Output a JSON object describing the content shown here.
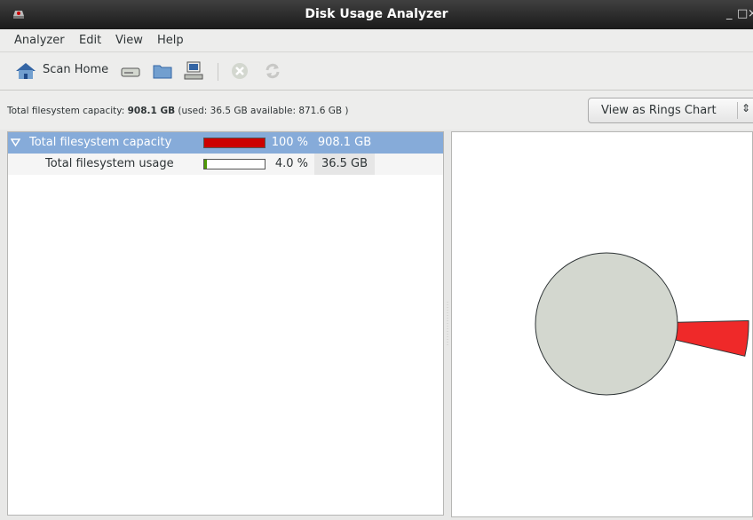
{
  "window": {
    "title": "Disk Usage Analyzer",
    "minimize": "_",
    "maximize": "□",
    "close": "×"
  },
  "menu": [
    "Analyzer",
    "Edit",
    "View",
    "Help"
  ],
  "toolbar": {
    "scan_home_label": "Scan Home"
  },
  "info": {
    "prefix": "Total filesystem capacity: ",
    "capacity": "908.1 GB",
    "suffix": " (used: 36.5 GB available: 871.6 GB )"
  },
  "view_combo": {
    "selected": "View as Rings Chart",
    "arrow": "⇕"
  },
  "tree": {
    "rows": [
      {
        "name": "Total filesystem capacity",
        "percent": "100 %",
        "size": "908.1 GB",
        "fill": 1.0,
        "fill_color": "#cc0000",
        "expanded": true,
        "selected": true
      },
      {
        "name": "Total filesystem usage",
        "percent": "4.0 %",
        "size": "36.5 GB",
        "fill": 0.04,
        "fill_color": "#4e9a06",
        "expanded": false,
        "selected": false
      }
    ]
  },
  "rings": {
    "center_color": "#d3d7cf",
    "segment_color": "#ef2929",
    "used_fraction": 0.04
  }
}
